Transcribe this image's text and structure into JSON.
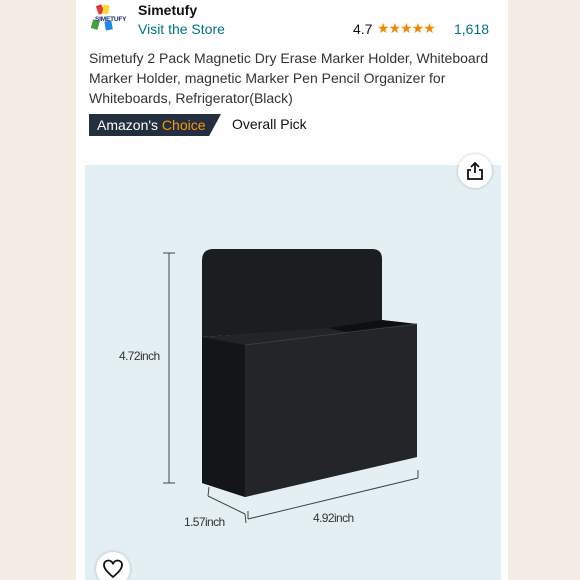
{
  "seller": {
    "logo_text": "SIMETUFY",
    "brand_name": "Simetufy",
    "visit_store": "Visit the Store"
  },
  "rating": {
    "value": "4.7",
    "stars": 4.7,
    "stars_glyphs": "★★★★★",
    "reviews_count": "1,618"
  },
  "product": {
    "title": "Simetufy 2 Pack Magnetic Dry Erase Marker Holder, Whiteboard Marker Holder, magnetic Marker Pen Pencil Organizer for Whiteboards, Refrigerator(Black)"
  },
  "badge": {
    "prefix": "Amazon's",
    "highlight": "Choice",
    "overall_pick": "Overall Pick"
  },
  "dimensions": {
    "height": "4.72inch",
    "depth": "1.57inch",
    "width": "4.92inch"
  },
  "icons": [
    "share-icon",
    "heart-icon",
    "star-icon"
  ],
  "colors": {
    "link": "#007185",
    "star": "#f08804",
    "badge_bg": "#232f3e",
    "badge_accent": "#ff9900",
    "image_bg": "#e4eff4",
    "page_bg": "#f3ece4"
  }
}
